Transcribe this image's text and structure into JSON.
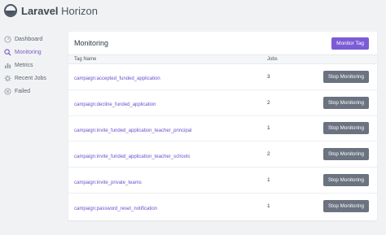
{
  "brand": {
    "name_bold": "Laravel",
    "name_rest": " Horizon"
  },
  "sidebar": {
    "items": [
      {
        "label": "Dashboard",
        "icon": "dashboard-icon",
        "active": false
      },
      {
        "label": "Monitoring",
        "icon": "search-icon",
        "active": true
      },
      {
        "label": "Metrics",
        "icon": "bar-chart-icon",
        "active": false
      },
      {
        "label": "Recent Jobs",
        "icon": "gear-icon",
        "active": false
      },
      {
        "label": "Failed",
        "icon": "close-circle-icon",
        "active": false
      }
    ]
  },
  "panel": {
    "title": "Monitoring",
    "monitor_button": "Monitor Tag",
    "columns": {
      "tag": "Tag Name",
      "jobs": "Jobs"
    },
    "stop_label": "Stop Monitoring",
    "rows": [
      {
        "tag": "campaign:accepted_funded_application",
        "jobs": "3"
      },
      {
        "tag": "campaign:decline_funded_application",
        "jobs": "2"
      },
      {
        "tag": "campaign:invite_funded_application_teacher_principal",
        "jobs": "1"
      },
      {
        "tag": "campaign:invite_funded_application_teacher_schools",
        "jobs": "2"
      },
      {
        "tag": "campaign:invite_private_teams",
        "jobs": "1"
      },
      {
        "tag": "campaign:password_reset_notification",
        "jobs": "1"
      }
    ]
  },
  "colors": {
    "accent": "#7c5cd6",
    "stop_button": "#6b7280",
    "link": "#6b4fcf"
  }
}
